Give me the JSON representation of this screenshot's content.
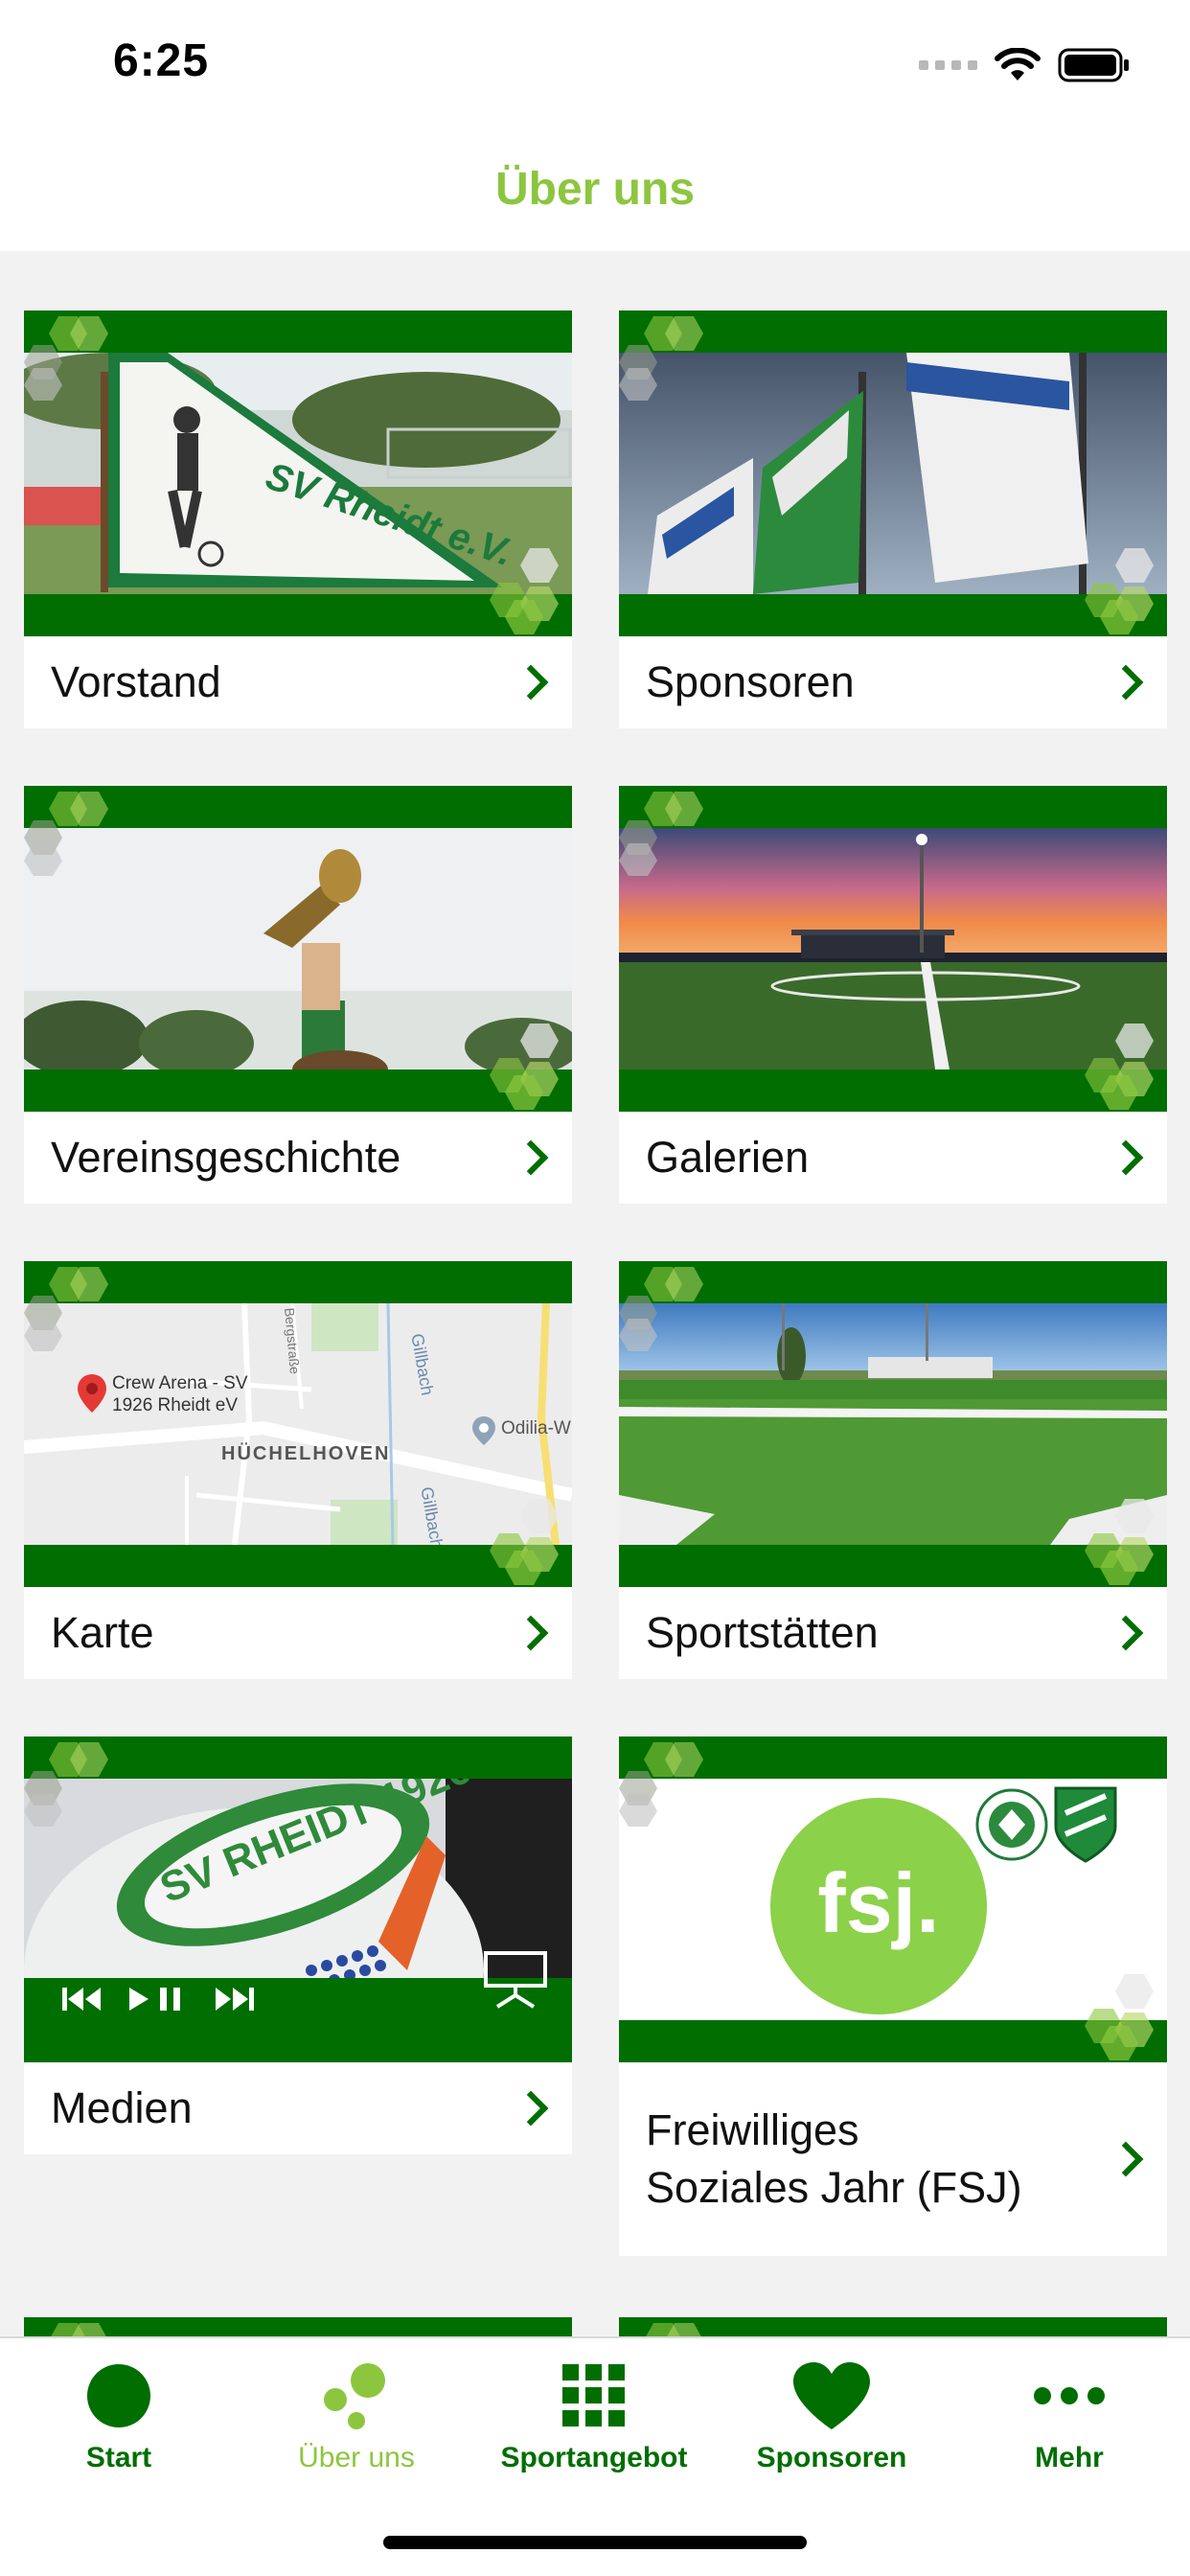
{
  "status": {
    "time": "6:25"
  },
  "header": {
    "title": "Über uns"
  },
  "cards": [
    {
      "label": "Vorstand"
    },
    {
      "label": "Sponsoren"
    },
    {
      "label": "Vereinsgeschichte"
    },
    {
      "label": "Galerien"
    },
    {
      "label": "Karte"
    },
    {
      "label": "Sportstätten"
    },
    {
      "label": "Medien"
    },
    {
      "label": "Freiwilliges Soziales Jahr (FSJ)"
    }
  ],
  "map": {
    "place_name": "Crew Arena - SV 1926 Rheidt eV",
    "district": "HÜCHELHOVEN",
    "poi": "Odilia-W",
    "street": "Gillbach",
    "street2": "Bergstraße"
  },
  "fsj_logo_text": "fsj.",
  "flag_text": "SV Rheidt e.V.",
  "cake_text": "SV RHEIDT 1926",
  "tabs": [
    {
      "label": "Start",
      "icon": "circle-icon",
      "active": false
    },
    {
      "label": "Über uns",
      "icon": "dots-icon",
      "active": true
    },
    {
      "label": "Sportangebot",
      "icon": "grid-icon",
      "active": false
    },
    {
      "label": "Sponsoren",
      "icon": "heart-icon",
      "active": false
    },
    {
      "label": "Mehr",
      "icon": "more-icon",
      "active": false
    }
  ],
  "colors": {
    "brand_green": "#006e00",
    "accent_green": "#8cc63f"
  }
}
